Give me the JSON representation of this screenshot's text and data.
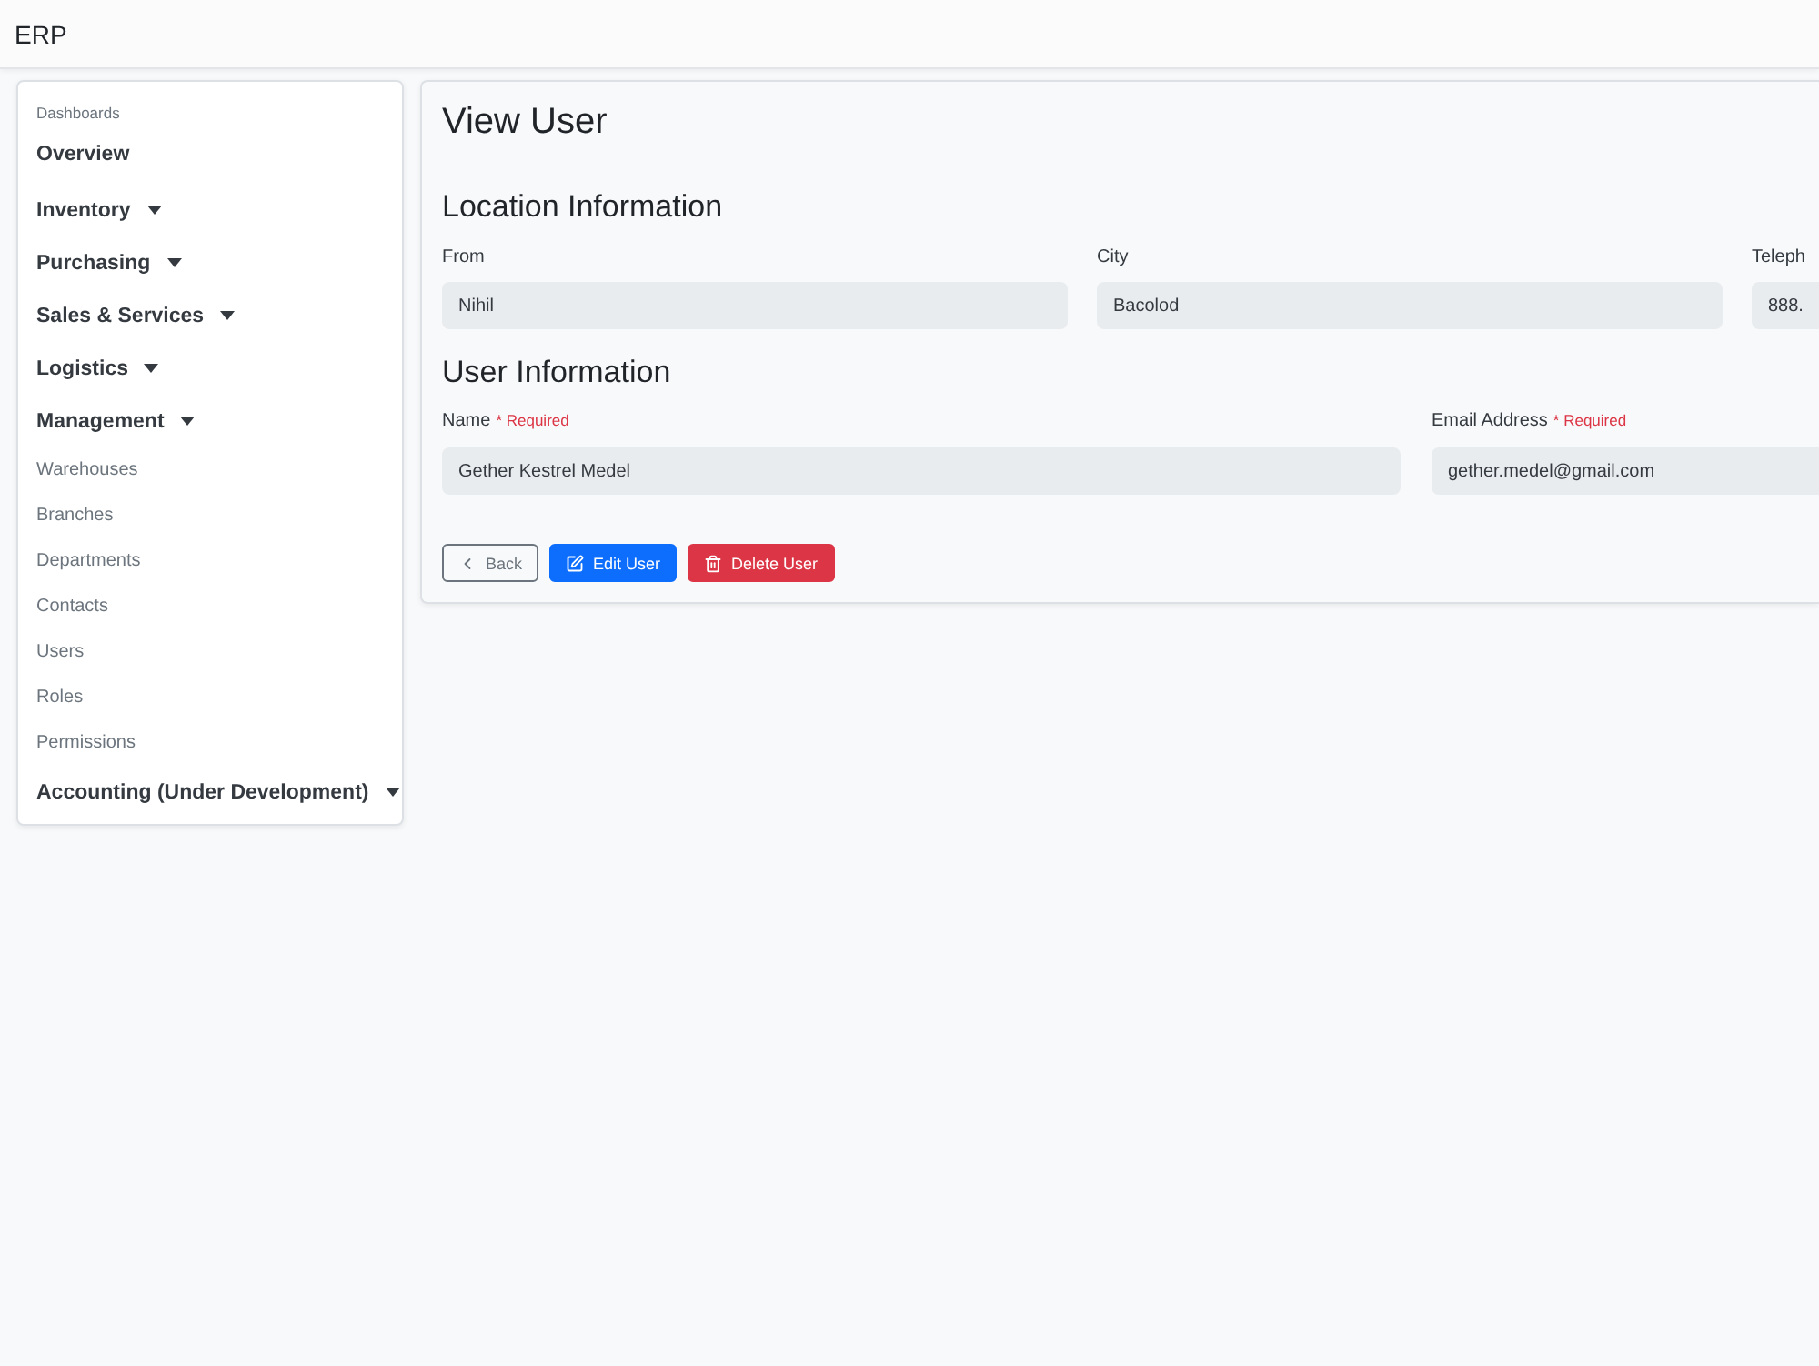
{
  "navbar": {
    "brand": "ERP"
  },
  "sidebar": {
    "heading": "Dashboards",
    "items": [
      {
        "label": "Overview",
        "kind": "link"
      },
      {
        "label": "Inventory",
        "kind": "dropdown"
      },
      {
        "label": "Purchasing",
        "kind": "dropdown"
      },
      {
        "label": "Sales & Services",
        "kind": "dropdown"
      },
      {
        "label": "Logistics",
        "kind": "dropdown"
      },
      {
        "label": "Management",
        "kind": "dropdown",
        "children": [
          {
            "label": "Warehouses"
          },
          {
            "label": "Branches"
          },
          {
            "label": "Departments"
          },
          {
            "label": "Contacts"
          },
          {
            "label": "Users"
          },
          {
            "label": "Roles"
          },
          {
            "label": "Permissions"
          }
        ]
      },
      {
        "label": "Accounting (Under Development)",
        "kind": "dropdown"
      }
    ]
  },
  "page": {
    "title": "View User",
    "sections": [
      {
        "title": "Location Information",
        "fields": [
          {
            "label": "From",
            "value": "Nihil"
          },
          {
            "label": "City",
            "value": "Bacolod"
          },
          {
            "label": "Teleph",
            "value": "888."
          }
        ]
      },
      {
        "title": "User Information",
        "fields": [
          {
            "label": "Name",
            "required_note": "* Required",
            "value": "Gether Kestrel Medel"
          },
          {
            "label": "Email Address",
            "required_note": "* Required",
            "value": "gether.medel@gmail.com"
          }
        ]
      }
    ],
    "buttons": [
      {
        "label": "Back",
        "kind": "back"
      },
      {
        "label": "Edit User",
        "kind": "edit"
      },
      {
        "label": "Delete User",
        "kind": "delete"
      }
    ]
  }
}
